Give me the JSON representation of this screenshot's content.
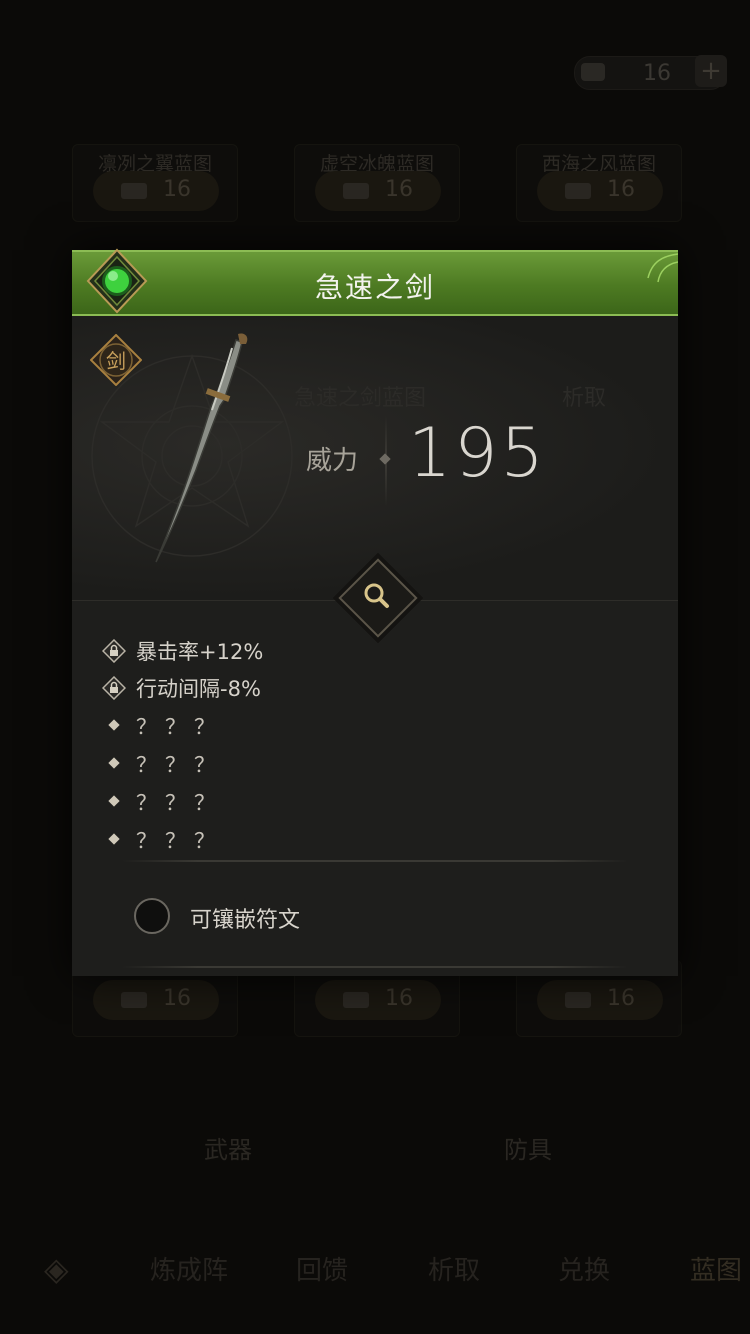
{
  "background": {
    "currency": {
      "value": "16"
    },
    "blueprints_top": [
      {
        "name": "凛冽之翼蓝图",
        "cost": "16"
      },
      {
        "name": "虚空冰魄蓝图",
        "cost": "16"
      },
      {
        "name": "西海之风蓝图",
        "cost": "16"
      }
    ],
    "blueprints_bottom": [
      {
        "cost": "16"
      },
      {
        "cost": "16"
      },
      {
        "cost": "16"
      }
    ],
    "category_tabs": [
      "武器",
      "防具"
    ],
    "bottom_nav": [
      "炼成阵",
      "回馈",
      "析取",
      "兑换",
      "蓝图"
    ]
  },
  "modal": {
    "title": "急速之剑",
    "type_badge": "剑",
    "faded_text": [
      "急速之剑蓝图",
      "析取"
    ],
    "power_label": "威力",
    "power_value": "195",
    "stats": [
      {
        "locked": true,
        "text": "暴击率+12%"
      },
      {
        "locked": true,
        "text": "行动间隔-8%"
      },
      {
        "locked": false,
        "text": "？？？"
      },
      {
        "locked": false,
        "text": "？？？"
      },
      {
        "locked": false,
        "text": "？？？"
      },
      {
        "locked": false,
        "text": "？？？"
      }
    ],
    "rune_label": "可镶嵌符文"
  },
  "colors": {
    "header_green": "#4d7a22",
    "header_border": "#8cbc54",
    "gem_green": "#3ed13e",
    "accent_gold": "#c9a15c"
  }
}
